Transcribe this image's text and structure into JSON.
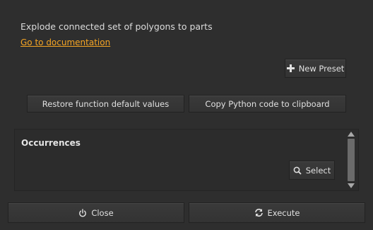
{
  "header": {
    "description": "Explode connected set of polygons to parts",
    "doc_link": "Go to documentation"
  },
  "buttons": {
    "new_preset": "New Preset",
    "restore_defaults": "Restore function default values",
    "copy_python": "Copy Python code to clipboard",
    "select": "Select",
    "close": "Close",
    "execute": "Execute"
  },
  "occurrences": {
    "title": "Occurrences"
  },
  "icons": {
    "new_preset": "plus-icon",
    "select": "search-icon",
    "close": "power-icon",
    "execute": "refresh-icon"
  },
  "colors": {
    "accent_link": "#f5a524",
    "background": "#2e2e2e"
  }
}
